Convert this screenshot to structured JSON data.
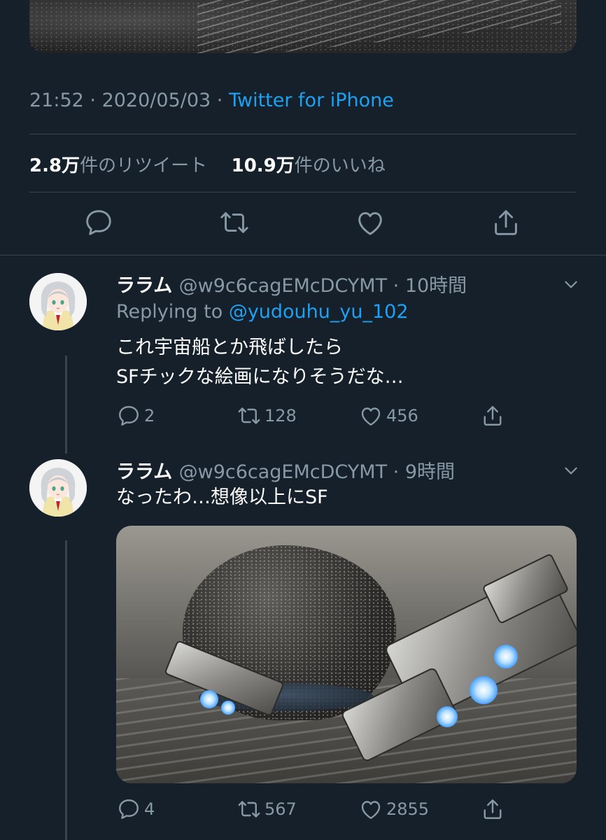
{
  "main_tweet": {
    "time": "21:52",
    "date": "2020/05/03",
    "source": "Twitter for iPhone",
    "retweets_count": "2.8万",
    "retweets_label": "件のリツイート",
    "likes_count": "10.9万",
    "likes_label": "件のいいね"
  },
  "replies": [
    {
      "display_name": "ララム",
      "handle": "@w9c6cagEMcDCYMT",
      "time_ago": "10時間",
      "replying_to_label": "Replying to",
      "replying_to_handle": "@yudouhu_yu_102",
      "text_line1": "これ宇宙船とか飛ばしたら",
      "text_line2": "SFチックな絵画になりそうだな…",
      "reply_count": "2",
      "retweet_count": "128",
      "like_count": "456"
    },
    {
      "display_name": "ララム",
      "handle": "@w9c6cagEMcDCYMT",
      "time_ago": "9時間",
      "text_line1": "なったわ…想像以上にSF",
      "reply_count": "4",
      "retweet_count": "567",
      "like_count": "2855"
    }
  ],
  "colors": {
    "background": "#15202b",
    "secondary_text": "#8899a6",
    "link": "#1da1f2",
    "divider": "#38444d"
  },
  "icons": [
    "reply-icon",
    "retweet-icon",
    "like-icon",
    "share-icon",
    "caret-down-icon"
  ]
}
